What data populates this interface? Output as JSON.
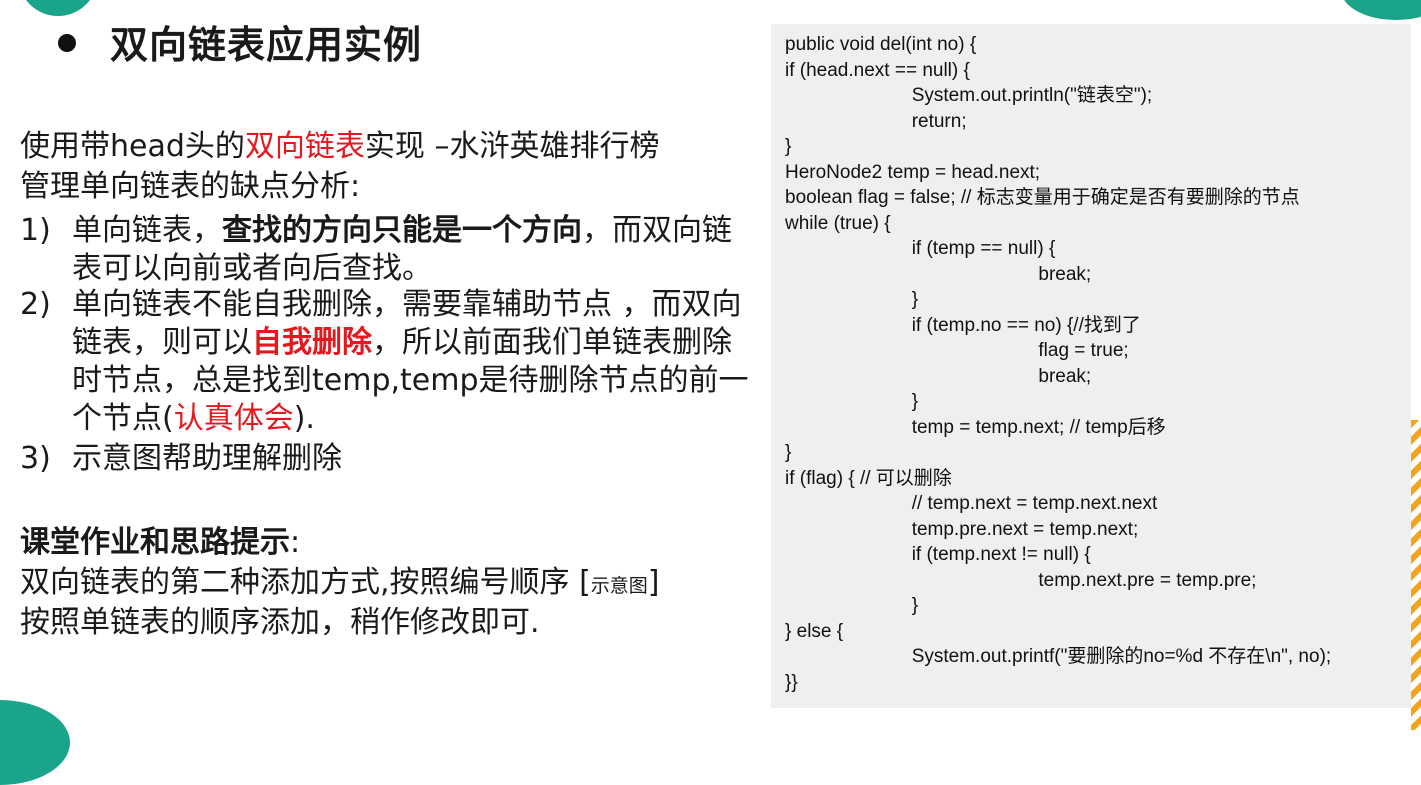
{
  "slide": {
    "title": "双向链表应用实例",
    "intro": {
      "prefix": "使用带head头的",
      "highlight": "双向链表",
      "suffix": "实现 –水浒英雄排行榜"
    },
    "analysis_heading": "管理单向链表的缺点分析:",
    "items": [
      {
        "num": "1)",
        "a": "单向链表，",
        "bold": "查找的方向只能是一个方向",
        "b": "，而双向链表可以向前或者向后查找。"
      },
      {
        "num": "2)",
        "a": "单向链表不能自我删除，需要靠辅助节点 ，而双向链表，则可以",
        "red_bold": "自我删除",
        "b": "，所以前面我们单链表删除时节点，总是找到temp,temp是待删除节点的前一个节点(",
        "red": "认真体会",
        "c": ")."
      },
      {
        "num": "3)",
        "a": "示意图帮助理解删除"
      }
    ],
    "homework": {
      "heading": "课堂作业和思路提示",
      "colon": ":",
      "line1": "双向链表的第二种添加方式,按照编号顺序 [",
      "line1_small": "示意图",
      "line1_end": "]",
      "line2": "按照单链表的顺序添加，稍作修改即可."
    }
  },
  "code": {
    "lines": [
      "public void del(int no) {",
      "if (head.next == null) {",
      "                        System.out.println(\"链表空\");",
      "                        return;",
      "}",
      "HeroNode2 temp = head.next;",
      "boolean flag = false; // 标志变量用于确定是否有要删除的节点",
      "while (true) {",
      "                        if (temp == null) {",
      "                                                break;",
      "                        }",
      "                        if (temp.no == no) {//找到了",
      "                                                flag = true;",
      "                                                break;",
      "                        }",
      "                        temp = temp.next; // temp后移",
      "}",
      "if (flag) { // 可以删除",
      "                        // temp.next = temp.next.next",
      "                        temp.pre.next = temp.next;",
      "                        if (temp.next != null) {",
      "                                                temp.next.pre = temp.pre;",
      "                        }",
      "} else {",
      "                        System.out.printf(\"要删除的no=%d 不存在\\n\", no);",
      "}}"
    ]
  }
}
